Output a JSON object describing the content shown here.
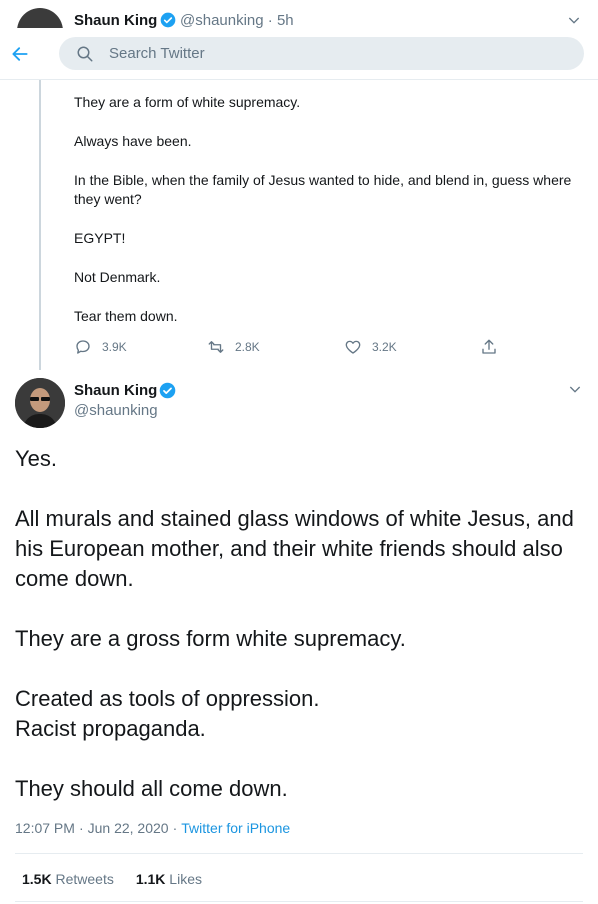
{
  "header": {
    "peek_name": "Shaun King",
    "peek_meta": "@shaunking · 5h",
    "search_placeholder": "Search Twitter"
  },
  "parent_tweet": {
    "paragraphs": [
      "They are a form of white supremacy.",
      "Always have been.",
      "In the Bible, when the family of Jesus wanted to hide, and blend in, guess where they went?",
      "EGYPT!",
      "Not Denmark.",
      "Tear them down."
    ],
    "actions": {
      "reply_count": "3.9K",
      "retweet_count": "2.8K",
      "like_count": "3.2K"
    }
  },
  "main_tweet": {
    "name": "Shaun King",
    "handle": "@shaunking",
    "paragraphs": [
      "Yes.",
      "All murals and stained glass windows of white Jesus, and his European mother, and their white friends should also come down.",
      "They are a gross form white supremacy.",
      "Created as tools of oppression.\nRacist propaganda.",
      "They should all come down."
    ],
    "time": "12:07 PM",
    "date": "Jun 22, 2020",
    "source": "Twitter for iPhone",
    "retweets_value": "1.5K",
    "retweets_label": "Retweets",
    "likes_value": "1.1K",
    "likes_label": "Likes"
  },
  "colors": {
    "accent": "#1da1f2",
    "muted": "#657786",
    "text": "#14171a"
  }
}
